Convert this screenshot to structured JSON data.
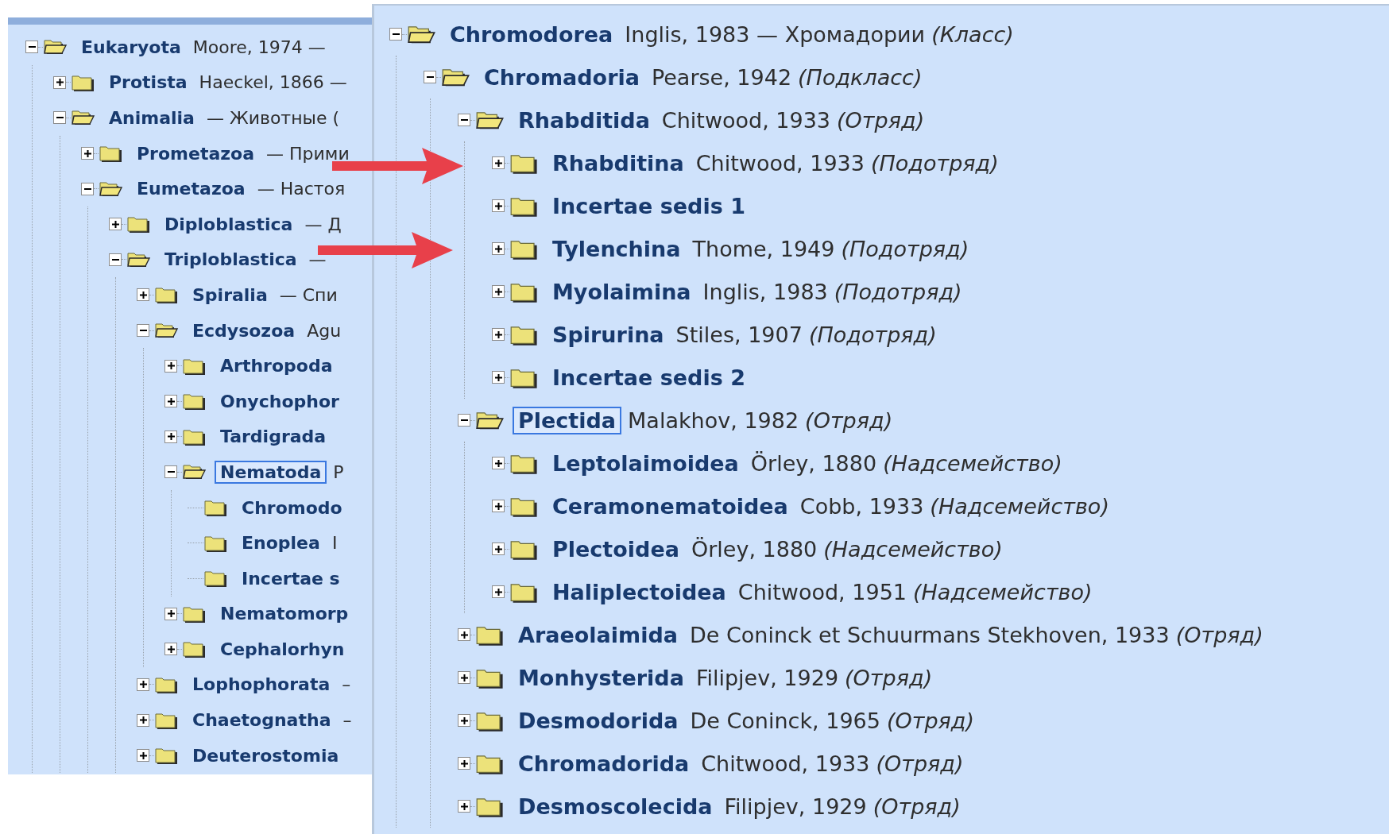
{
  "panels": [
    {
      "tree": [
        {
          "name": "Eukaryota",
          "authority": "Moore, 1974 —",
          "kind": "branch",
          "expanded": true,
          "selected": false,
          "children": [
            {
              "name": "Protista",
              "authority": "Haeckel, 1866 —",
              "kind": "branch",
              "expanded": false,
              "selected": false
            },
            {
              "name": "Animalia",
              "authority": "— Животные (",
              "kind": "branch",
              "expanded": true,
              "selected": false,
              "children": [
                {
                  "name": "Prometazoa",
                  "authority": "— Прими",
                  "kind": "branch",
                  "expanded": false,
                  "selected": false
                },
                {
                  "name": "Eumetazoa",
                  "authority": "— Настоя",
                  "kind": "branch",
                  "expanded": true,
                  "selected": false,
                  "children": [
                    {
                      "name": "Diploblastica",
                      "authority": "— Д",
                      "kind": "branch",
                      "expanded": false,
                      "selected": false
                    },
                    {
                      "name": "Triploblastica",
                      "authority": "—",
                      "kind": "branch",
                      "expanded": true,
                      "selected": false,
                      "children": [
                        {
                          "name": "Spiralia",
                          "authority": "— Спи",
                          "kind": "branch",
                          "expanded": false,
                          "selected": false
                        },
                        {
                          "name": "Ecdysozoa",
                          "authority": "Agu",
                          "kind": "branch",
                          "expanded": true,
                          "selected": false,
                          "children": [
                            {
                              "name": "Arthropoda",
                              "kind": "branch",
                              "expanded": false,
                              "selected": false
                            },
                            {
                              "name": "Onychophor",
                              "kind": "branch",
                              "expanded": false,
                              "selected": false
                            },
                            {
                              "name": "Tardigrada",
                              "kind": "branch",
                              "expanded": false,
                              "selected": false
                            },
                            {
                              "name": "Nematoda",
                              "authority": "P",
                              "kind": "branch",
                              "expanded": true,
                              "selected": true,
                              "children": [
                                {
                                  "name": "Chromodo",
                                  "kind": "leaf",
                                  "selected": false
                                },
                                {
                                  "name": "Enoplea",
                                  "authority": "I",
                                  "kind": "leaf",
                                  "selected": false
                                },
                                {
                                  "name": "Incertae s",
                                  "kind": "leaf",
                                  "selected": false
                                }
                              ]
                            },
                            {
                              "name": "Nematomorp",
                              "kind": "branch",
                              "expanded": false,
                              "selected": false
                            },
                            {
                              "name": "Cephalorhyn",
                              "kind": "branch",
                              "expanded": false,
                              "selected": false
                            }
                          ]
                        },
                        {
                          "name": "Lophophorata",
                          "authority": "–",
                          "kind": "branch",
                          "expanded": false,
                          "selected": false
                        },
                        {
                          "name": "Chaetognatha",
                          "authority": "–",
                          "kind": "branch",
                          "expanded": false,
                          "selected": false
                        },
                        {
                          "name": "Deuterostomia",
                          "kind": "branch",
                          "expanded": false,
                          "selected": false
                        }
                      ]
                    }
                  ]
                }
              ]
            }
          ]
        }
      ]
    },
    {
      "tree": [
        {
          "name": "Chromodorea",
          "authority": "Inglis, 1983 — Хромадории",
          "rank": "(Класс)",
          "kind": "branch",
          "expanded": true,
          "selected": false,
          "children": [
            {
              "name": "Chromadoria",
              "authority": "Pearse, 1942",
              "rank": "(Подкласс)",
              "kind": "branch",
              "expanded": true,
              "selected": false,
              "children": [
                {
                  "name": "Rhabditida",
                  "authority": "Chitwood, 1933",
                  "rank": "(Отряд)",
                  "kind": "branch",
                  "expanded": true,
                  "selected": false,
                  "children": [
                    {
                      "name": "Rhabditina",
                      "authority": "Chitwood, 1933",
                      "rank": "(Подотряд)",
                      "kind": "branch",
                      "expanded": false,
                      "selected": false
                    },
                    {
                      "name": "Incertae sedis 1",
                      "kind": "branch",
                      "expanded": false,
                      "selected": false
                    },
                    {
                      "name": "Tylenchina",
                      "authority": "Thome, 1949",
                      "rank": "(Подотряд)",
                      "kind": "branch",
                      "expanded": false,
                      "selected": false
                    },
                    {
                      "name": "Myolaimina",
                      "authority": "Inglis, 1983",
                      "rank": "(Подотряд)",
                      "kind": "branch",
                      "expanded": false,
                      "selected": false
                    },
                    {
                      "name": "Spirurina",
                      "authority": "Stiles, 1907",
                      "rank": "(Подотряд)",
                      "kind": "branch",
                      "expanded": false,
                      "selected": false
                    },
                    {
                      "name": "Incertae sedis 2",
                      "kind": "branch",
                      "expanded": false,
                      "selected": false
                    }
                  ]
                },
                {
                  "name": "Plectida",
                  "authority": "Malakhov, 1982",
                  "rank": "(Отряд)",
                  "kind": "branch",
                  "expanded": true,
                  "selected": true,
                  "children": [
                    {
                      "name": "Leptolaimoidea",
                      "authority": "Örley, 1880",
                      "rank": "(Надсемейство)",
                      "kind": "branch",
                      "expanded": false,
                      "selected": false
                    },
                    {
                      "name": "Ceramonematoidea",
                      "authority": "Cobb, 1933",
                      "rank": "(Надсемейство)",
                      "kind": "branch",
                      "expanded": false,
                      "selected": false
                    },
                    {
                      "name": "Plectoidea",
                      "authority": "Örley, 1880",
                      "rank": "(Надсемейство)",
                      "kind": "branch",
                      "expanded": false,
                      "selected": false
                    },
                    {
                      "name": "Haliplectoidea",
                      "authority": "Chitwood, 1951",
                      "rank": "(Надсемейство)",
                      "kind": "branch",
                      "expanded": false,
                      "selected": false
                    }
                  ]
                },
                {
                  "name": "Araeolaimida",
                  "authority": "De Coninck et Schuurmans Stekhoven, 1933",
                  "rank": "(Отряд)",
                  "kind": "branch",
                  "expanded": false,
                  "selected": false
                },
                {
                  "name": "Monhysterida",
                  "authority": "Filipjev, 1929",
                  "rank": "(Отряд)",
                  "kind": "branch",
                  "expanded": false,
                  "selected": false
                },
                {
                  "name": "Desmodorida",
                  "authority": "De Coninck, 1965",
                  "rank": "(Отряд)",
                  "kind": "branch",
                  "expanded": false,
                  "selected": false
                },
                {
                  "name": "Chromadorida",
                  "authority": "Chitwood, 1933",
                  "rank": "(Отряд)",
                  "kind": "branch",
                  "expanded": false,
                  "selected": false
                },
                {
                  "name": "Desmoscolecida",
                  "authority": "Filipjev, 1929",
                  "rank": "(Отряд)",
                  "kind": "branch",
                  "expanded": false,
                  "selected": false
                }
              ]
            }
          ]
        }
      ]
    }
  ]
}
